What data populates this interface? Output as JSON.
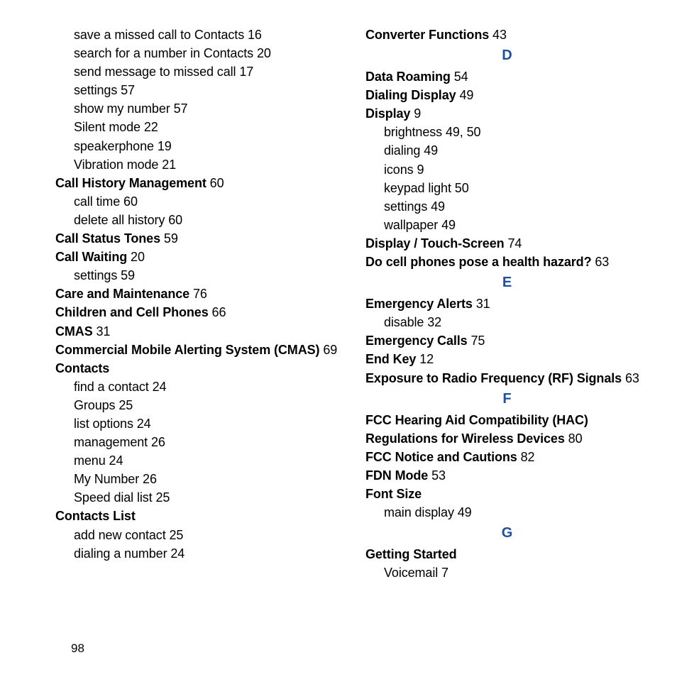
{
  "page_number": "98",
  "letters": {
    "D": "D",
    "E": "E",
    "F": "F",
    "G": "G"
  },
  "left_column": [
    {
      "type": "sub",
      "text": "save a missed call to Contacts",
      "page": "16"
    },
    {
      "type": "sub",
      "text": "search for a number in Contacts",
      "page": "20"
    },
    {
      "type": "sub",
      "text": "send message to missed call",
      "page": "17"
    },
    {
      "type": "sub",
      "text": "settings",
      "page": "57"
    },
    {
      "type": "sub",
      "text": "show my number",
      "page": "57"
    },
    {
      "type": "sub",
      "text": "Silent mode",
      "page": "22"
    },
    {
      "type": "sub",
      "text": "speakerphone",
      "page": "19"
    },
    {
      "type": "sub",
      "text": "Vibration mode",
      "page": "21"
    },
    {
      "type": "main",
      "text": "Call History Management",
      "page": "60"
    },
    {
      "type": "sub",
      "text": "call time",
      "page": "60"
    },
    {
      "type": "sub",
      "text": "delete all history",
      "page": "60"
    },
    {
      "type": "main",
      "text": "Call Status Tones",
      "page": "59"
    },
    {
      "type": "main",
      "text": "Call Waiting",
      "page": "20"
    },
    {
      "type": "sub",
      "text": "settings",
      "page": "59"
    },
    {
      "type": "main",
      "text": "Care and Maintenance",
      "page": "76"
    },
    {
      "type": "main",
      "text": "Children and Cell Phones",
      "page": "66"
    },
    {
      "type": "main",
      "text": "CMAS",
      "page": "31"
    },
    {
      "type": "main",
      "text": "Commercial Mobile Alerting System (CMAS)",
      "page": "69"
    },
    {
      "type": "main",
      "text": "Contacts",
      "page": ""
    },
    {
      "type": "sub",
      "text": "find a contact",
      "page": "24"
    },
    {
      "type": "sub",
      "text": "Groups",
      "page": "25"
    },
    {
      "type": "sub",
      "text": "list options",
      "page": "24"
    },
    {
      "type": "sub",
      "text": "management",
      "page": "26"
    },
    {
      "type": "sub",
      "text": "menu",
      "page": "24"
    },
    {
      "type": "sub",
      "text": "My Number",
      "page": "26"
    },
    {
      "type": "sub",
      "text": "Speed dial list",
      "page": "25"
    },
    {
      "type": "main",
      "text": "Contacts List",
      "page": ""
    },
    {
      "type": "sub",
      "text": "add new contact",
      "page": "25"
    },
    {
      "type": "sub",
      "text": "dialing a number",
      "page": "24"
    }
  ],
  "right_column": [
    {
      "type": "main",
      "text": "Converter Functions",
      "page": "43"
    },
    {
      "type": "letter",
      "key": "D"
    },
    {
      "type": "main",
      "text": "Data Roaming",
      "page": "54"
    },
    {
      "type": "main",
      "text": "Dialing Display",
      "page": "49"
    },
    {
      "type": "main",
      "text": "Display",
      "page": "9"
    },
    {
      "type": "sub",
      "text": "brightness",
      "page": "49, 50"
    },
    {
      "type": "sub",
      "text": "dialing",
      "page": "49"
    },
    {
      "type": "sub",
      "text": "icons",
      "page": "9"
    },
    {
      "type": "sub",
      "text": "keypad light",
      "page": "50"
    },
    {
      "type": "sub",
      "text": "settings",
      "page": "49"
    },
    {
      "type": "sub",
      "text": "wallpaper",
      "page": "49"
    },
    {
      "type": "main",
      "text": "Display / Touch-Screen",
      "page": "74"
    },
    {
      "type": "main",
      "text": "Do cell phones pose a health hazard?",
      "page": "63"
    },
    {
      "type": "letter",
      "key": "E"
    },
    {
      "type": "main",
      "text": "Emergency Alerts",
      "page": "31"
    },
    {
      "type": "sub",
      "text": "disable",
      "page": "32"
    },
    {
      "type": "main",
      "text": "Emergency Calls",
      "page": "75"
    },
    {
      "type": "main",
      "text": "End Key",
      "page": "12"
    },
    {
      "type": "main",
      "text": "Exposure to Radio Frequency (RF) Signals",
      "page": "63"
    },
    {
      "type": "letter",
      "key": "F"
    },
    {
      "type": "main",
      "text": "FCC Hearing Aid Compatibility (HAC) Regulations for Wireless Devices",
      "page": "80"
    },
    {
      "type": "main",
      "text": "FCC Notice and Cautions",
      "page": "82"
    },
    {
      "type": "main",
      "text": "FDN Mode",
      "page": "53"
    },
    {
      "type": "main",
      "text": "Font Size",
      "page": ""
    },
    {
      "type": "sub",
      "text": "main display",
      "page": "49"
    },
    {
      "type": "letter",
      "key": "G"
    },
    {
      "type": "main",
      "text": "Getting Started",
      "page": ""
    },
    {
      "type": "sub",
      "text": "Voicemail",
      "page": "7"
    }
  ]
}
